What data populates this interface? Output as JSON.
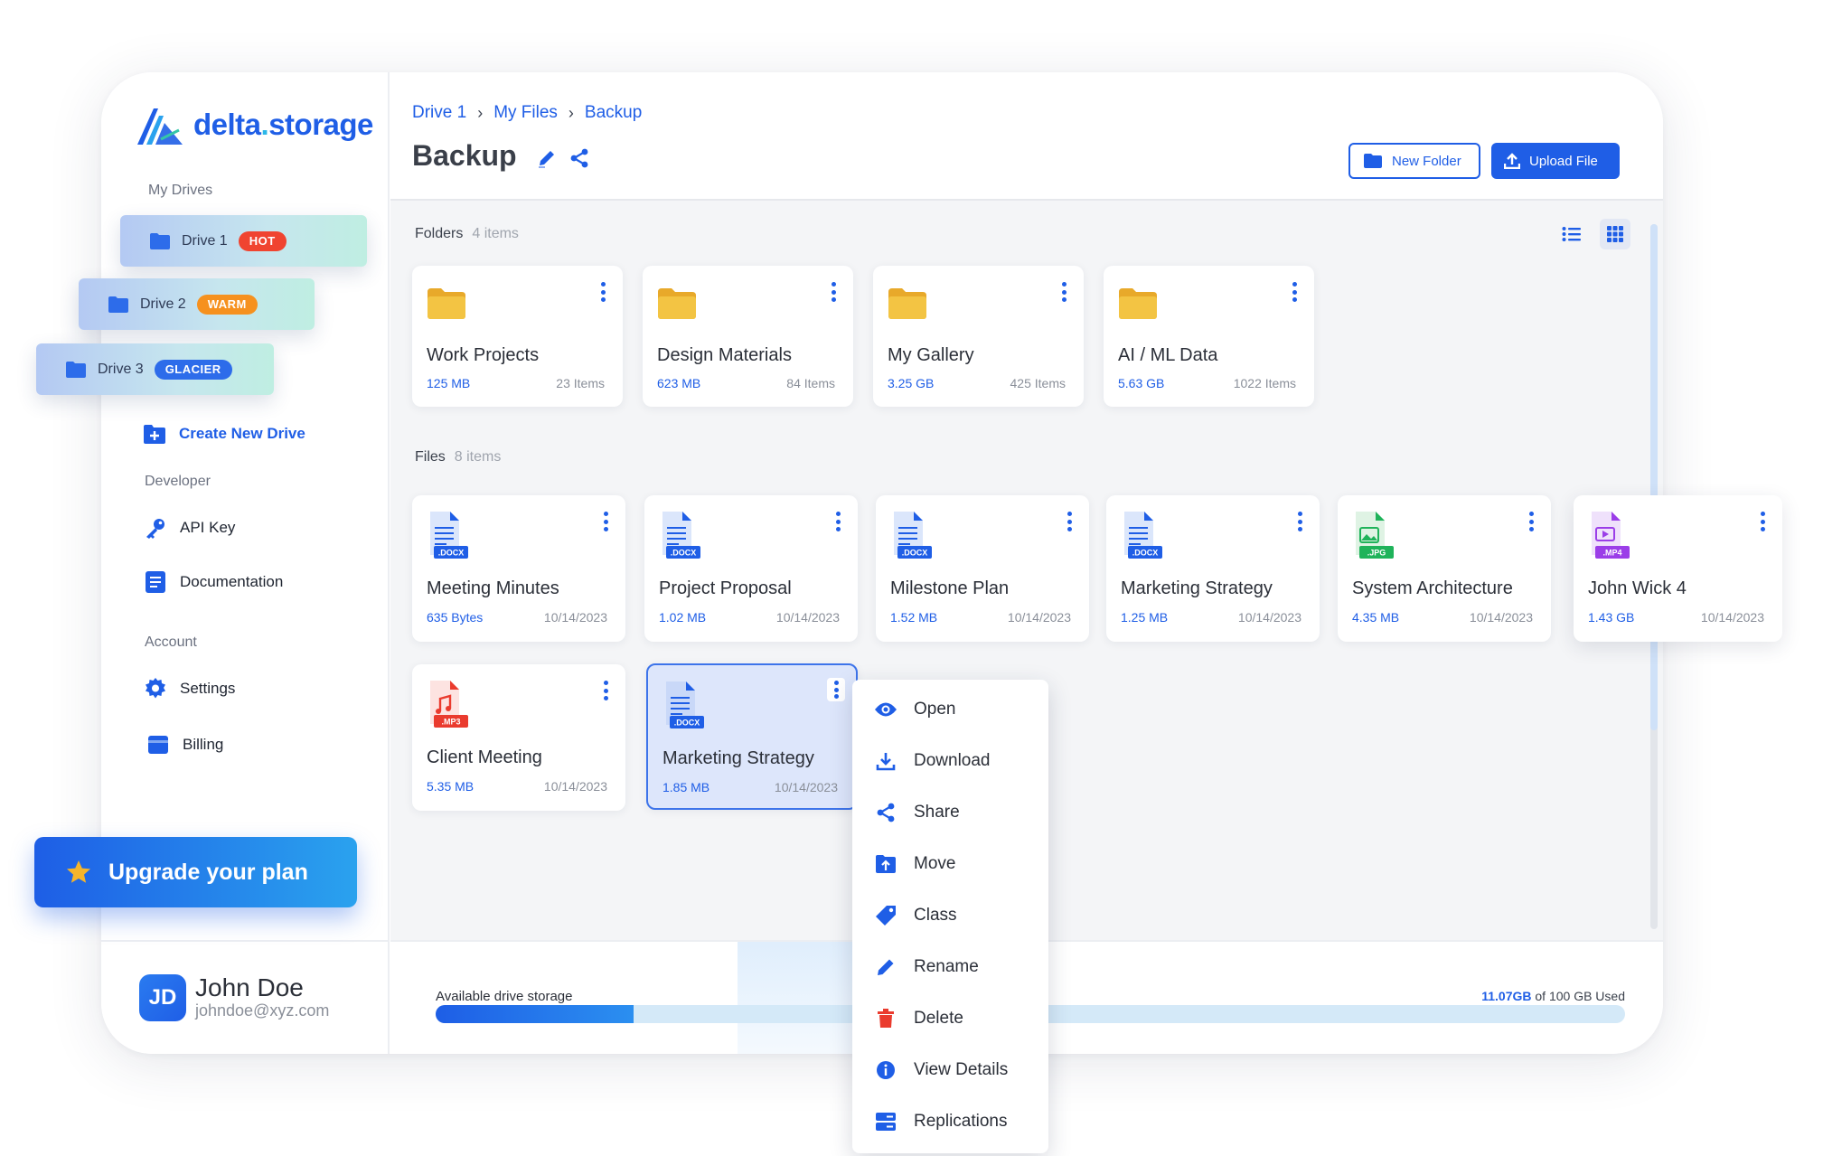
{
  "brand": {
    "name_main": "delta",
    "name_dot": ".",
    "name_tail": "storage"
  },
  "sidebar": {
    "my_drives_label": "My Drives",
    "drives": [
      {
        "label": "Drive 1",
        "badge": "HOT"
      },
      {
        "label": "Drive 2",
        "badge": "WARM"
      },
      {
        "label": "Drive 3",
        "badge": "GLACIER"
      }
    ],
    "create_drive": "Create New Drive",
    "developer_label": "Developer",
    "developer_items": [
      "API Key",
      "Documentation"
    ],
    "account_label": "Account",
    "account_items": [
      "Settings",
      "Billing"
    ],
    "upgrade": "Upgrade your plan"
  },
  "user": {
    "initials": "JD",
    "name": "John Doe",
    "email": "johndoe@xyz.com"
  },
  "header": {
    "breadcrumb": [
      "Drive 1",
      "My Files",
      "Backup"
    ],
    "title": "Backup",
    "new_folder": "New Folder",
    "upload_file": "Upload File"
  },
  "folders": {
    "label": "Folders",
    "count": "4 items",
    "items": [
      {
        "name": "Work Projects",
        "size": "125 MB",
        "meta": "23 Items"
      },
      {
        "name": "Design Materials",
        "size": "623 MB",
        "meta": "84 Items"
      },
      {
        "name": "My Gallery",
        "size": "3.25 GB",
        "meta": "425 Items"
      },
      {
        "name": "AI / ML Data",
        "size": "5.63 GB",
        "meta": "1022 Items"
      }
    ]
  },
  "files": {
    "label": "Files",
    "count": "8 items",
    "items": [
      {
        "name": "Meeting Minutes",
        "size": "635 Bytes",
        "date": "10/14/2023",
        "ext": ".DOCX"
      },
      {
        "name": "Project Proposal",
        "size": "1.02 MB",
        "date": "10/14/2023",
        "ext": ".DOCX"
      },
      {
        "name": "Milestone Plan",
        "size": "1.52 MB",
        "date": "10/14/2023",
        "ext": ".DOCX"
      },
      {
        "name": "Marketing Strategy",
        "size": "1.25 MB",
        "date": "10/14/2023",
        "ext": ".DOCX"
      },
      {
        "name": "System Architecture",
        "size": "4.35 MB",
        "date": "10/14/2023",
        "ext": ".JPG"
      },
      {
        "name": "John Wick 4",
        "size": "1.43 GB",
        "date": "10/14/2023",
        "ext": ".MP4"
      },
      {
        "name": "Client Meeting",
        "size": "5.35 MB",
        "date": "10/14/2023",
        "ext": ".MP3"
      },
      {
        "name": "Marketing Strategy",
        "size": "1.85 MB",
        "date": "10/14/2023",
        "ext": ".DOCX"
      }
    ]
  },
  "context_menu": [
    "Open",
    "Download",
    "Share",
    "Move",
    "Class",
    "Rename",
    "Delete",
    "View Details",
    "Replications"
  ],
  "storage": {
    "label": "Available drive storage",
    "used_value": "11.07GB",
    "used_suffix": " of 100 GB Used",
    "used_fraction": 0.1107
  },
  "colors": {
    "accent": "#1f5ee6",
    "hot": "#f04430",
    "warm": "#f6911e",
    "glacier": "#2d6cea",
    "folder": "#f3c443"
  }
}
